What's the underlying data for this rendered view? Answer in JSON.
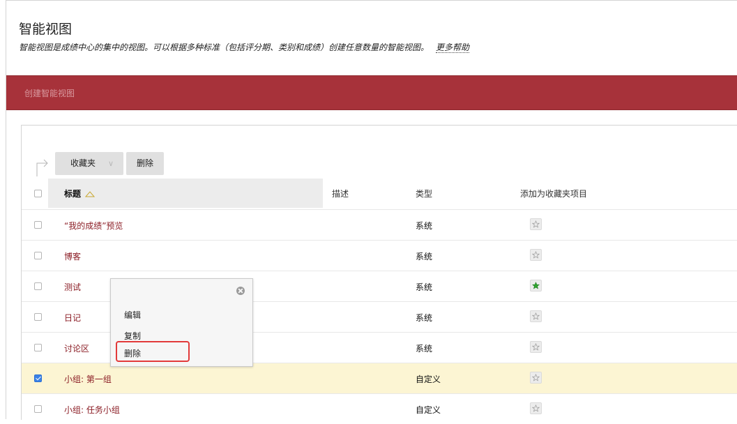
{
  "header": {
    "title": "智能视图",
    "subtitle": "智能视图是成绩中心的集中的视图。可以根据多种标准（包括评分期、类别和成绩）创建任意数量的智能视图。",
    "help_link": "更多帮助"
  },
  "action_bar": {
    "create_label": "创建智能视图"
  },
  "toolbar": {
    "favorites_label": "收藏夹",
    "delete_label": "删除"
  },
  "table": {
    "columns": {
      "title": "标题",
      "description": "描述",
      "type": "类型",
      "favorite": "添加为收藏夹项目"
    },
    "rows": [
      {
        "name": "“我的成绩”预览",
        "type": "系统",
        "favorite": false,
        "checked": false
      },
      {
        "name": "博客",
        "type": "系统",
        "favorite": false,
        "checked": false
      },
      {
        "name": "测试",
        "type": "系统",
        "favorite": true,
        "checked": false
      },
      {
        "name": "日记",
        "type": "系统",
        "favorite": false,
        "checked": false
      },
      {
        "name": "讨论区",
        "type": "系统",
        "favorite": false,
        "checked": false
      },
      {
        "name": "小组: 第一组",
        "type": "自定义",
        "favorite": false,
        "checked": true
      },
      {
        "name": "小组: 任务小组",
        "type": "自定义",
        "favorite": false,
        "checked": false
      }
    ]
  },
  "context_menu": {
    "items": [
      "编辑",
      "复制",
      "删除"
    ],
    "highlighted": "删除"
  },
  "colors": {
    "accent_bar": "#a7323a",
    "link": "#8b1d25",
    "selected_row": "#fcf5d3",
    "favorite_star": "#2fa52f",
    "highlight_border": "#e23a3a"
  },
  "icons": {
    "close": "close-circle-icon",
    "star": "star-icon",
    "sort": "sort-up-triangle-icon",
    "arrow": "bulk-action-arrow-icon",
    "chevron": "chevron-down-icon"
  }
}
